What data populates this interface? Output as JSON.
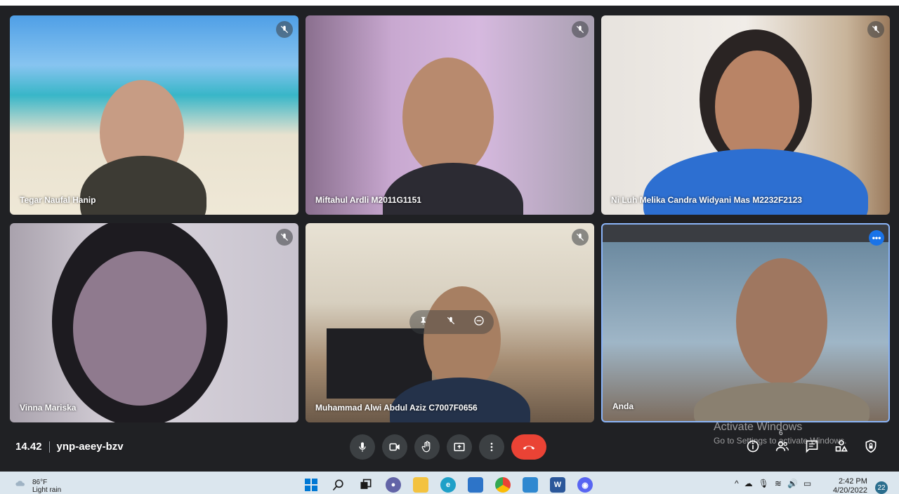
{
  "participants": [
    {
      "name": "Tegar Naufal Hanip",
      "muted": true
    },
    {
      "name": "Miftahul Ardli M2011G1151",
      "muted": true
    },
    {
      "name": "Ni Luh Melika Candra Widyani Mas M2232F2123",
      "muted": true
    },
    {
      "name": "Vinna Mariska",
      "muted": true
    },
    {
      "name": "Muhammad Alwi Abdul Aziz C7007F0656",
      "muted": true
    },
    {
      "name": "Anda",
      "muted": false
    }
  ],
  "meeting": {
    "time": "14.42",
    "code": "ynp-aeey-bzv"
  },
  "controls": {
    "mic": "mic-icon",
    "camera": "camera-icon",
    "raise_hand": "hand-icon",
    "present": "present-icon",
    "more": "more-vert-icon",
    "end": "end-call-icon"
  },
  "right_controls": {
    "people_count": "6"
  },
  "watermark": {
    "line1": "Activate Windows",
    "line2": "Go to Settings to activate Windows."
  },
  "taskbar": {
    "weather_temp": "86°F",
    "weather_desc": "Light rain",
    "time": "2:42 PM",
    "date": "4/20/2022",
    "notifications": "22"
  },
  "colors": {
    "accent": "#8ab4f8",
    "end_call": "#ea4335",
    "background": "#202124"
  }
}
